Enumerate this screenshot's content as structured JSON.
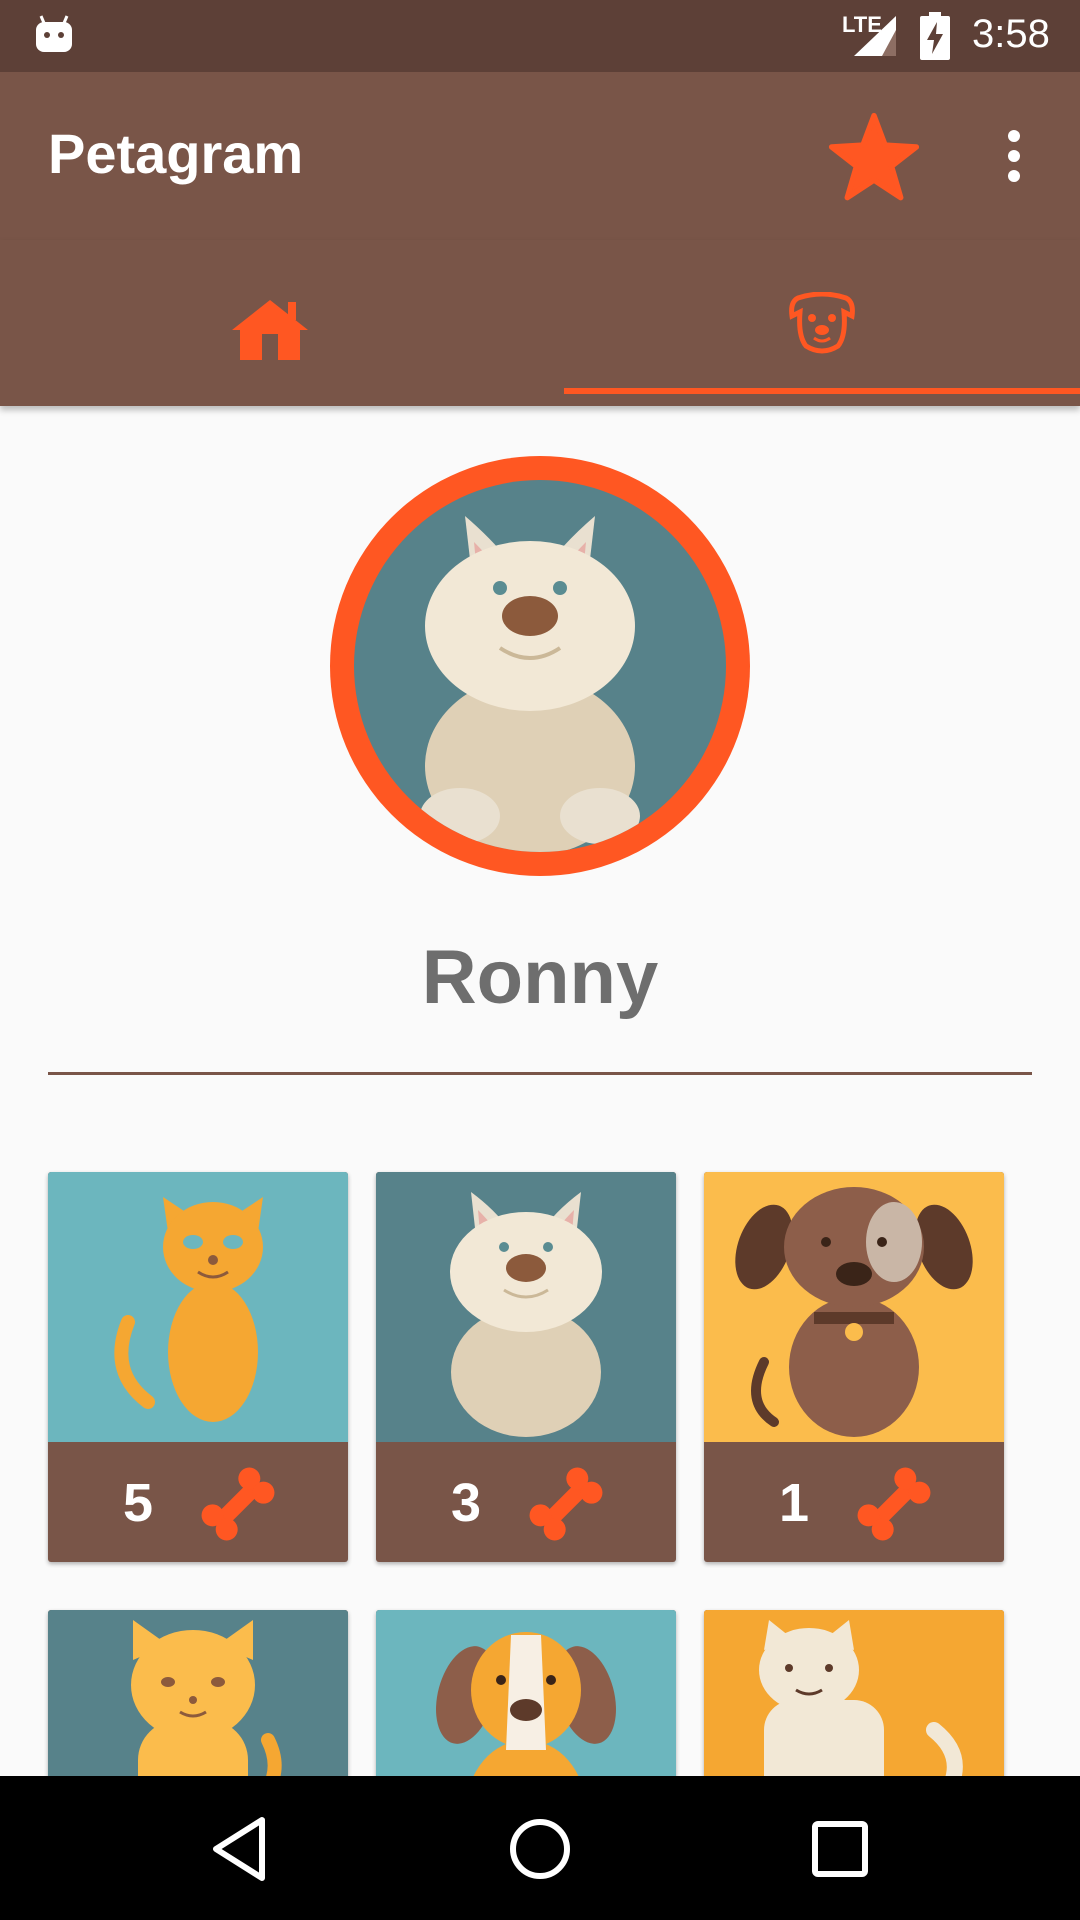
{
  "status_bar": {
    "network_label": "LTE",
    "time": "3:58"
  },
  "app_bar": {
    "title": "Petagram",
    "favorite_icon": "star-icon",
    "menu_icon": "more-vert-icon"
  },
  "tabs": [
    {
      "name": "home",
      "icon": "home-icon",
      "selected": false
    },
    {
      "name": "profile",
      "icon": "dog-face-icon",
      "selected": true
    }
  ],
  "profile": {
    "name": "Ronny"
  },
  "pets": [
    {
      "animal": "cat",
      "likes": "5",
      "bg_color": "#6cb6be"
    },
    {
      "animal": "dog",
      "likes": "3",
      "bg_color": "#57828a"
    },
    {
      "animal": "dog",
      "likes": "1",
      "bg_color": "#fbbc4c"
    },
    {
      "animal": "cat",
      "bg_color": "#57828a"
    },
    {
      "animal": "dog",
      "bg_color": "#6cb6be"
    },
    {
      "animal": "cat",
      "bg_color": "#f5a732"
    }
  ],
  "colors": {
    "primary": "#795548",
    "primary_dark": "#5d4037",
    "accent": "#ff5722",
    "background": "#fafafa"
  }
}
